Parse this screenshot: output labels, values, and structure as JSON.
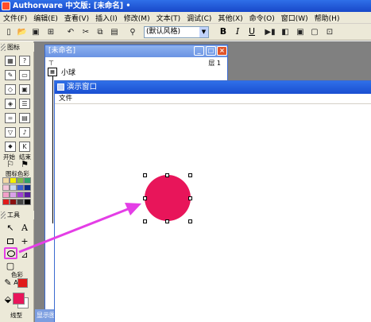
{
  "app": {
    "title": "Authorware 中文版: [未命名] •"
  },
  "menu": [
    "文件(F)",
    "编辑(E)",
    "查看(V)",
    "插入(I)",
    "修改(M)",
    "文本(T)",
    "调试(C)",
    "其他(X)",
    "命令(O)",
    "窗口(W)",
    "帮助(H)"
  ],
  "toolbar": {
    "style_value": "(默认风格)",
    "bold": "B",
    "italic": "I",
    "underline": "U"
  },
  "palette": {
    "header": "图标",
    "start_label": "开始",
    "end_label": "结束",
    "colors_label": "图标色彩",
    "tools_header": "工具",
    "color_label": "色彩",
    "line_label": "线型",
    "swatches": [
      "#f2d9a6",
      "#f5f000",
      "#7fb84a",
      "#2fa36b",
      "#f4c5da",
      "#c8d8f0",
      "#3c5fd1",
      "#0a2a8a",
      "#f2a0c8",
      "#d9a0e8",
      "#9d3fd0",
      "#5a1aa0",
      "#e11a1a",
      "#8a1010",
      "#444444",
      "#000000"
    ]
  },
  "flow_window": {
    "title": "[未命名]",
    "layer": "层 1",
    "icon_label": "小球"
  },
  "presentation": {
    "title": "演示窗口",
    "menu_file": "文件",
    "ball_color": "#e8155a"
  },
  "bottom_tab": {
    "label": "显示图"
  },
  "annotation": {
    "arrow_color": "#e43ee6"
  }
}
